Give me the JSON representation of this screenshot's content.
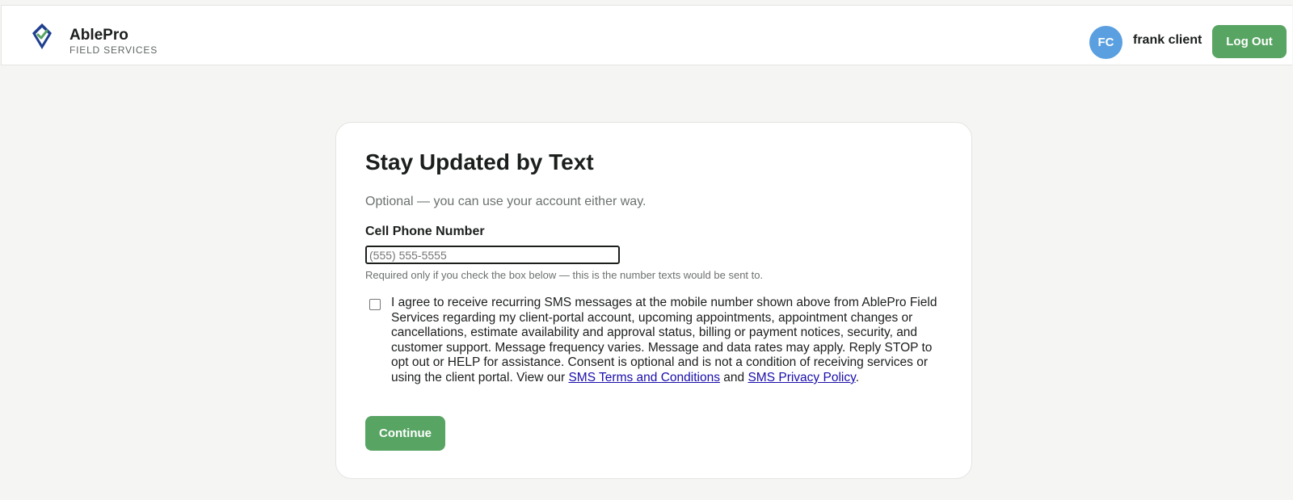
{
  "brand": {
    "name": "AblePro",
    "tagline": "FIELD SERVICES",
    "logo_icon": "map-pin-check-icon",
    "colors": {
      "logo_blue": "#1f3f8f",
      "logo_green": "#58a463"
    }
  },
  "header": {
    "avatar_initials": "FC",
    "user_name": "frank client",
    "logout_label": "Log Out"
  },
  "card": {
    "title": "Stay Updated by Text",
    "subtitle": "Optional — you can use your account either way.",
    "phone_label": "Cell Phone Number",
    "phone_value": "",
    "phone_placeholder": "(555) 555-5555",
    "phone_hint": "Required only if you check the box below — this is the number texts would be sent to.",
    "consent_checked": false,
    "consent_text": "I agree to receive recurring SMS messages at the mobile number shown above from AblePro Field Services regarding my client-portal account, upcoming appointments, appointment changes or cancellations, estimate availability and approval status, billing or payment notices, security, and customer support. Message frequency varies. Message and data rates may apply. Reply STOP to opt out or HELP for assistance. Consent is optional and is not a condition of receiving services or using the client portal. View our",
    "terms_link": "SMS Terms and Conditions",
    "and_text": "and",
    "privacy_link": "SMS Privacy Policy",
    "period": ".",
    "continue_label": "Continue"
  },
  "colors": {
    "accent_green": "#58a463",
    "avatar_blue": "#5a9fe0",
    "link_blue": "#1a0dab",
    "page_bg": "#f5f6f4"
  }
}
